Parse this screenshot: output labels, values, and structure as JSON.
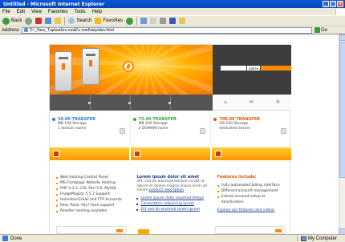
{
  "window": {
    "title": "Untitled - Microsoft Internet Explorer"
  },
  "menu": [
    "File",
    "Edit",
    "View",
    "Favorites",
    "Tools",
    "Help"
  ],
  "toolbar": {
    "back_label": "Back",
    "search_label": "Search",
    "favorites_label": "Favorites"
  },
  "address": {
    "label": "Address",
    "url": "D:\\_New_Tupload\\zo.ozaE\\c:cmd\\step\\dev.html",
    "go_label": "Go"
  },
  "site": {
    "search": {
      "domain_option": "com"
    },
    "plans": [
      {
        "price": "50.00 TRANSFER",
        "features": [
          "MB 100 Storage",
          "1 domain name"
        ],
        "color": "#2a7de1"
      },
      {
        "price": "75.00 TRANSFER",
        "features": [
          "MB 200 Storage",
          "2 DOMAIN name"
        ],
        "color": "#3aa33a"
      },
      {
        "price": "700.00 TRANSFER",
        "features": [
          "GB 100 Storage",
          "dedicated Server"
        ],
        "color": "#e05a00"
      }
    ],
    "left_list": [
      "Web Hosting Control Panel",
      "MS Frontpage Website Hosting",
      "PHP 4.3.3, CGI, Perl 5.6, MySQL",
      "ImageMagick 5.5.2 Support",
      "Unlimited Email and FTP Accounts",
      "Real, Pano, Pay? form support",
      "Reseller Hosting available"
    ],
    "middle": {
      "heading": "Lorem ipsum dolor sit amet",
      "body": "elit, sed do eiusmod tempor incidit ut labore et dolore magna aliqua enim ad minim",
      "link": "product sescription",
      "links": [
        "Lorem ipsum dolor eiusmod tempo",
        "Consectetur adipiscing ipsum",
        "Elit sed do eiusmod lorem ipsum"
      ]
    },
    "right": {
      "title": "Features include:",
      "items": [
        "Fully automated billing interface",
        "Different account management",
        "Instant account setup or deactivation"
      ],
      "link": "Explore our features and videos"
    }
  },
  "status": {
    "left": "Done",
    "zone": "My Computer"
  }
}
